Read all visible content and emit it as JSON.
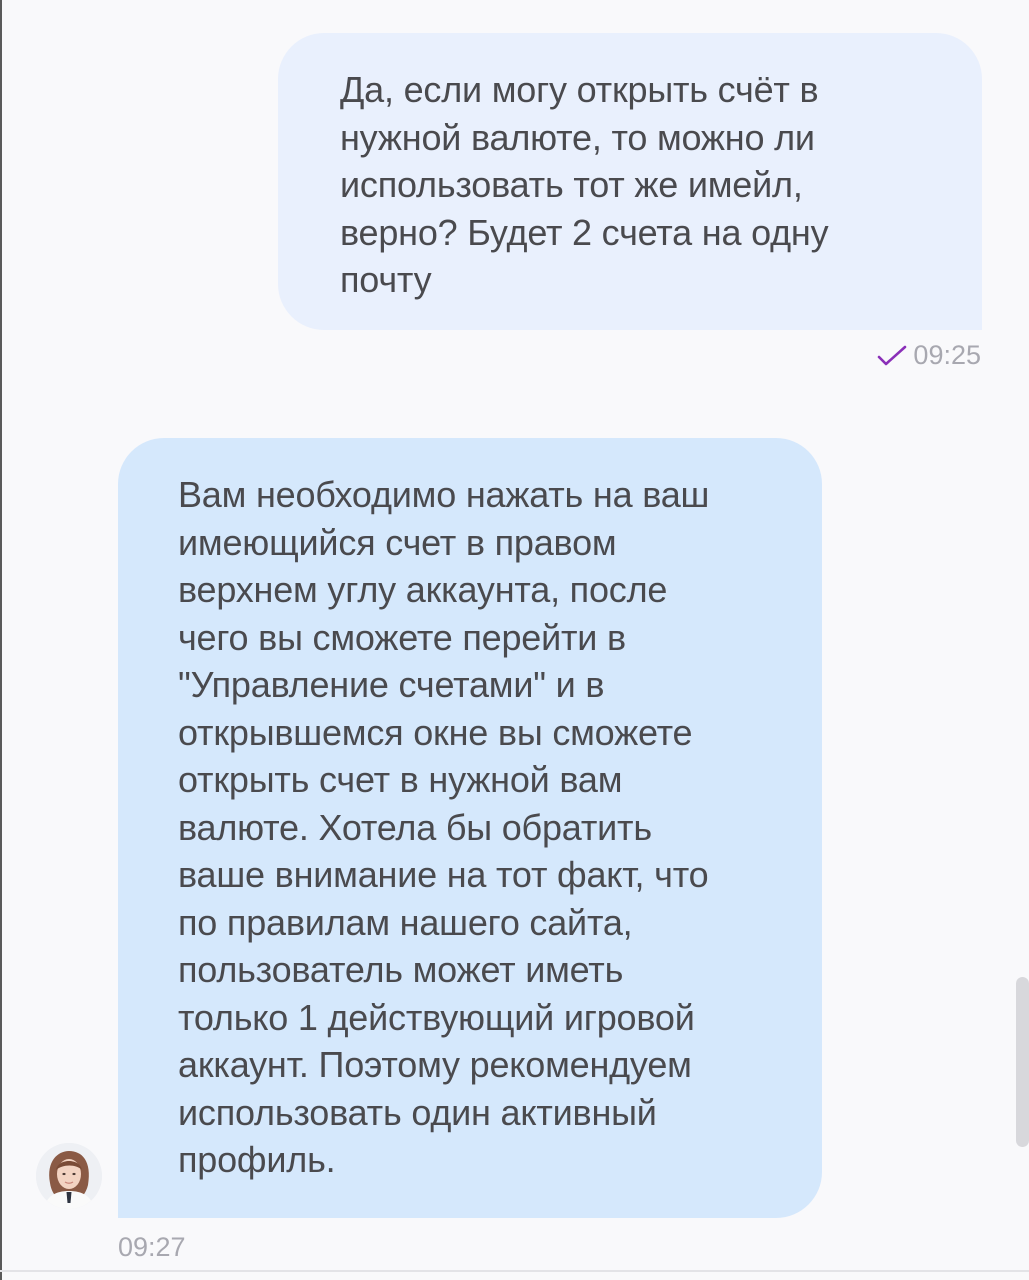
{
  "chat": {
    "messages": [
      {
        "direction": "outgoing",
        "text": "Да, если могу открыть счёт в\nнужной валюте, то можно ли\nиспользовать тот же имейл,\nверно? Будет 2 счета на одну\nпочту",
        "time": "09:25",
        "status_icon": "check-icon",
        "status_color": "#8a2fb8"
      },
      {
        "direction": "incoming",
        "text": "Вам необходимо нажать на ваш\nимеющийся счет в правом\nверхнем углу аккаунта, после\nчего вы сможете перейти в\n\"Управление счетами\" и в\nоткрывшемся окне вы сможете\nоткрыть счет в нужной вам\nвалюте. Хотела бы обратить\nваше внимание на тот факт, что\nпо правилам нашего сайта,\nпользователь может иметь\nтолько 1 действующий игровой\nаккаунт. Поэтому рекомендуем\nиспользовать один активный\nпрофиль.",
        "time": "09:27",
        "avatar_icon": "agent-avatar"
      }
    ]
  },
  "colors": {
    "background": "#f9f9fb",
    "outgoing_bubble": "#e9f0fd",
    "incoming_bubble": "#d5e8fc",
    "text": "#4a4a4e",
    "timestamp": "#a8a8b0",
    "check": "#8a2fb8"
  }
}
